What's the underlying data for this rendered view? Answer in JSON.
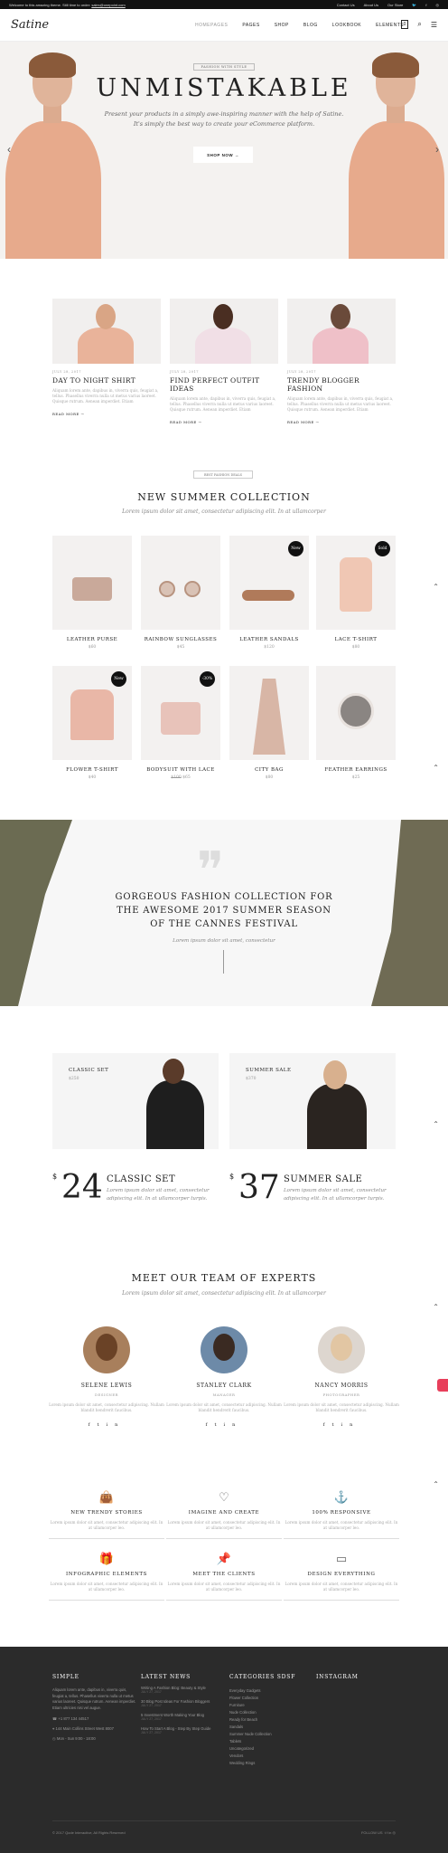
{
  "topbar": {
    "promo": "Welcome to this amazing theme. Still time to order:",
    "email": "sales@onepoint.com",
    "links": [
      "Contact Us",
      "About Us",
      "Our Store"
    ],
    "social": [
      "twitter-icon",
      "facebook-icon",
      "instagram-icon"
    ]
  },
  "header": {
    "logo": "Satine",
    "nav": [
      "HOMEPAGES",
      "PAGES",
      "SHOP",
      "BLOG",
      "LOOKBOOK",
      "ELEMENTS"
    ],
    "cart_count": "0"
  },
  "hero": {
    "tag": "FASHION WITH STYLE",
    "title": "UNMISTAKABLE",
    "subtitle1": "Present your products in a simply awe-inspiring manner with the help of Satine.",
    "subtitle2": "It's simply the best way to create your eCommerce platform.",
    "button": "SHOP NOW"
  },
  "posts": [
    {
      "date": "JULY 28, 2017",
      "title": "DAY TO NIGHT SHIRT",
      "excerpt": "Aliquam lorem ante, dapibus in, viverra quis, feugiat a, tellus. Phasellus viverra nulla ut metus varius laoreet. Quisque rutrum. Aenean imperdiet. Etiam",
      "more": "READ MORE"
    },
    {
      "date": "JULY 28, 2017",
      "title": "FIND PERFECT OUTFIT IDEAS",
      "excerpt": "Aliquam lorem ante, dapibus in, viverra quis, feugiat a, tellus. Phasellus viverra nulla ut metus varius laoreet. Quisque rutrum. Aenean imperdiet. Etiam",
      "more": "READ MORE"
    },
    {
      "date": "JULY 28, 2017",
      "title": "TRENDY BLOGGER FASHION",
      "excerpt": "Aliquam lorem ante, dapibus in, viverra quis, feugiat a, tellus. Phasellus viverra nulla ut metus varius laoreet. Quisque rutrum. Aenean imperdiet. Etiam",
      "more": "READ MORE"
    }
  ],
  "collection": {
    "tag": "BEST FASHION DEALS",
    "title": "NEW SUMMER COLLECTION",
    "subtitle": "Lorem ipsum dolor sit amet, consectetur adipiscing elit. In at ullamcorper"
  },
  "products": [
    {
      "name": "LEATHER PURSE",
      "price": "$60",
      "badge": ""
    },
    {
      "name": "RAINBOW SUNGLASSES",
      "price": "$45",
      "badge": ""
    },
    {
      "name": "LEATHER SANDALS",
      "price": "$120",
      "badge": "New"
    },
    {
      "name": "LACE T-SHIRT",
      "price": "$80",
      "badge": "Sold"
    },
    {
      "name": "FLOWER T-SHIRT",
      "price": "$40",
      "badge": "New"
    },
    {
      "name": "BODYSUIT WITH LACE",
      "old_price": "$100",
      "price": "$65",
      "badge": "-30%"
    },
    {
      "name": "CITY BAG",
      "price": "$80",
      "badge": ""
    },
    {
      "name": "FEATHER EARRINGS",
      "price": "$25",
      "badge": ""
    }
  ],
  "quote": {
    "line1": "GORGEOUS FASHION COLLECTION FOR",
    "line2": "THE AWESOME 2017 SUMMER SEASON",
    "line3": "OF THE CANNES FESTIVAL",
    "cite": "Lorem ipsum dolor sit amet, consectetur"
  },
  "combos": [
    {
      "title": "CLASSIC SET",
      "price": "$250"
    },
    {
      "title": "SUMMER SALE",
      "price": "$370"
    }
  ],
  "price_blocks": [
    {
      "currency": "$",
      "amount": "24",
      "name": "CLASSIC SET",
      "desc": "Lorem ipsum dolor sit amet, consectetur adipiscing elit. In at ullamcorper turpis."
    },
    {
      "currency": "$",
      "amount": "37",
      "name": "SUMMER SALE",
      "desc": "Lorem ipsum dolor sit amet, consectetur adipiscing elit. In at ullamcorper turpis."
    }
  ],
  "team": {
    "title": "MEET OUR TEAM OF EXPERTS",
    "subtitle": "Lorem ipsum dolor sit amet, consectetur adipiscing elit. In at ullamcorper",
    "members": [
      {
        "name": "SELENE LEWIS",
        "role": "DESIGNER",
        "desc": "Lorem ipsum dolor sit amet, consectetur adipiscing. Nullam blandit hendrerit faucibus."
      },
      {
        "name": "STANLEY CLARK",
        "role": "MANAGER",
        "desc": "Lorem ipsum dolor sit amet, consectetur adipiscing. Nullam blandit hendrerit faucibus."
      },
      {
        "name": "NANCY MORRIS",
        "role": "PHOTOGRAPHER",
        "desc": "Lorem ipsum dolor sit amet, consectetur adipiscing. Nullam blandit hendrerit faucibus."
      }
    ]
  },
  "features": [
    {
      "icon": "shopping-bag-icon",
      "title": "NEW TRENDY STORIES",
      "desc": "Lorem ipsum dolor sit amet, consectetur adipiscing elit. In at ullamcorper leo."
    },
    {
      "icon": "heart-icon",
      "title": "IMAGINE AND CREATE",
      "desc": "Lorem ipsum dolor sit amet, consectetur adipiscing elit. In at ullamcorper leo."
    },
    {
      "icon": "anchor-icon",
      "title": "100% RESPONSIVE",
      "desc": "Lorem ipsum dolor sit amet, consectetur adipiscing elit. In at ullamcorper leo."
    },
    {
      "icon": "gift-icon",
      "title": "INFOGRAPHIC ELEMENTS",
      "desc": "Lorem ipsum dolor sit amet, consectetur adipiscing elit. In at ullamcorper leo."
    },
    {
      "icon": "pin-icon",
      "title": "MEET THE CLIENTS",
      "desc": "Lorem ipsum dolor sit amet, consectetur adipiscing elit. In at ullamcorper leo."
    },
    {
      "icon": "card-icon",
      "title": "DESIGN EVERYTHING",
      "desc": "Lorem ipsum dolor sit amet, consectetur adipiscing elit. In at ullamcorper leo."
    }
  ],
  "footer": {
    "simple": {
      "title": "SIMPLE",
      "text": "Aliquam lorem ante, dapibus in, viverra quis, feugiat a, tellus. Phasellus viverra nulla ut metus varius laoreet. Quisque rutrum. Aenean imperdiet. Etiam ultricies nisi vel augue.",
      "phone": "+1 877 134 44517",
      "address": "144 Main Collins Street West 8007",
      "hours": "Mon - Sun 9:00 - 18:00"
    },
    "news": {
      "title": "LATEST NEWS",
      "items": [
        {
          "t": "Writing A Fashion Blog: Beauty & Style",
          "d": "JULY 27, 2017"
        },
        {
          "t": "30 Blog Post Ideas For Fashion Bloggers",
          "d": "JULY 27, 2017"
        },
        {
          "t": "5 Investment Worth Making Your Blog",
          "d": "JULY 27, 2017"
        },
        {
          "t": "How To Start A Blog - Step By Step Guide",
          "d": "JULY 27, 2017"
        }
      ]
    },
    "categories": {
      "title": "CATEGORIES SDSF",
      "items": [
        "Everyday Gadgets",
        "Flower Collection",
        "Furniture",
        "Nude Collection",
        "Ready for Beach",
        "Sandals",
        "Summer Nude Collection",
        "Tablets",
        "Uncategorized",
        "Vendors",
        "Wedding Rings"
      ]
    },
    "instagram": {
      "title": "INSTAGRAM"
    },
    "copyright": "© 2017 Qode Interactive, All Rights Reserved",
    "follow": "FOLLOW US"
  }
}
